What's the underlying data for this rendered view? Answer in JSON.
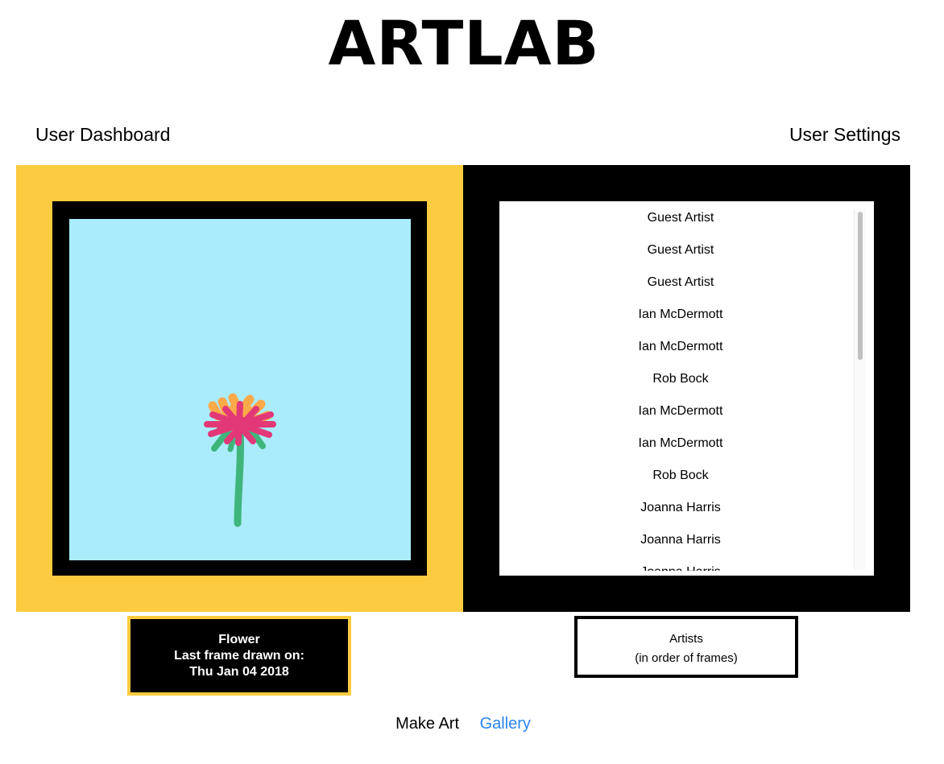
{
  "app": {
    "logo": "ARTLAB"
  },
  "header_nav": {
    "dashboard": "User Dashboard",
    "settings": "User Settings"
  },
  "artwork": {
    "canvas_color": "#aaecfb",
    "frame_color": "#000000",
    "panel_color": "#fdcb40",
    "title": "Flower",
    "last_frame_label": "Last frame drawn on:",
    "last_frame_date": "Thu Jan 04 2018"
  },
  "artists": {
    "items": [
      "Guest Artist",
      "Guest Artist",
      "Guest Artist",
      "Ian McDermott",
      "Ian McDermott",
      "Rob Bock",
      "Ian McDermott",
      "Ian McDermott",
      "Rob Bock",
      "Joanna Harris",
      "Joanna Harris",
      "Joanna Harris"
    ],
    "caption_title": "Artists",
    "caption_sub": "(in order of frames)",
    "scroll_position_fraction": 0.0
  },
  "footer_nav": {
    "make_art": "Make Art",
    "gallery": "Gallery",
    "gallery_color": "#2c84f0"
  }
}
